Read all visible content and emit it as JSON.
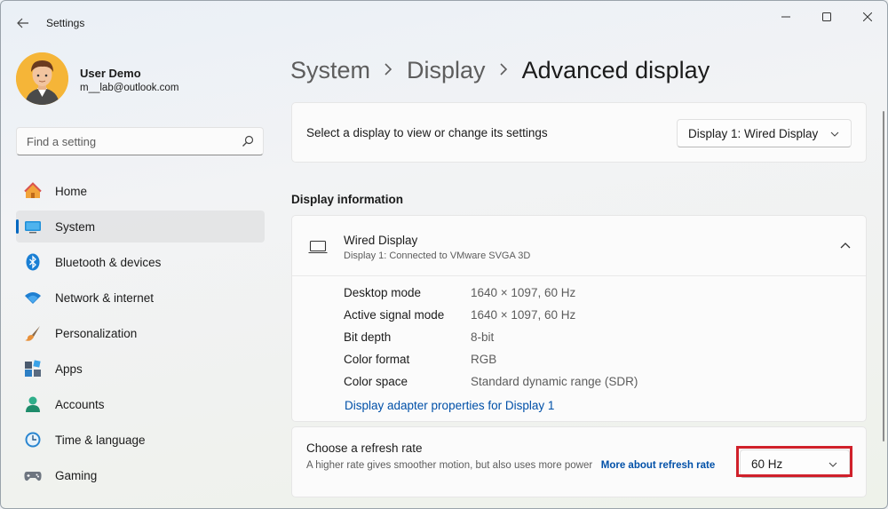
{
  "app": {
    "title": "Settings"
  },
  "user": {
    "name": "User Demo",
    "email": "m__lab@outlook.com"
  },
  "search": {
    "placeholder": "Find a setting"
  },
  "sidebar": {
    "items": [
      {
        "label": "Home",
        "icon": "home-icon"
      },
      {
        "label": "System",
        "icon": "system-icon",
        "active": true
      },
      {
        "label": "Bluetooth & devices",
        "icon": "bluetooth-icon"
      },
      {
        "label": "Network & internet",
        "icon": "network-icon"
      },
      {
        "label": "Personalization",
        "icon": "brush-icon"
      },
      {
        "label": "Apps",
        "icon": "apps-icon"
      },
      {
        "label": "Accounts",
        "icon": "accounts-icon"
      },
      {
        "label": "Time & language",
        "icon": "clock-icon"
      },
      {
        "label": "Gaming",
        "icon": "gamepad-icon"
      }
    ]
  },
  "breadcrumb": {
    "part1": "System",
    "part2": "Display",
    "current": "Advanced display"
  },
  "select_display": {
    "label": "Select a display to view or change its settings",
    "value": "Display 1: Wired Display"
  },
  "display_info": {
    "section_title": "Display information",
    "name": "Wired Display",
    "subtitle": "Display 1: Connected to VMware SVGA 3D",
    "rows": [
      {
        "key": "Desktop mode",
        "value": "1640 × 1097, 60 Hz"
      },
      {
        "key": "Active signal mode",
        "value": "1640 × 1097, 60 Hz"
      },
      {
        "key": "Bit depth",
        "value": "8-bit"
      },
      {
        "key": "Color format",
        "value": "RGB"
      },
      {
        "key": "Color space",
        "value": "Standard dynamic range (SDR)"
      }
    ],
    "adapter_link": "Display adapter properties for Display 1"
  },
  "refresh_rate": {
    "title": "Choose a refresh rate",
    "description": "A higher rate gives smoother motion, but also uses more power",
    "link": "More about refresh rate",
    "value": "60 Hz"
  },
  "colors": {
    "accent": "#0067c0",
    "highlight": "#d0202a",
    "link": "#0050a8"
  }
}
